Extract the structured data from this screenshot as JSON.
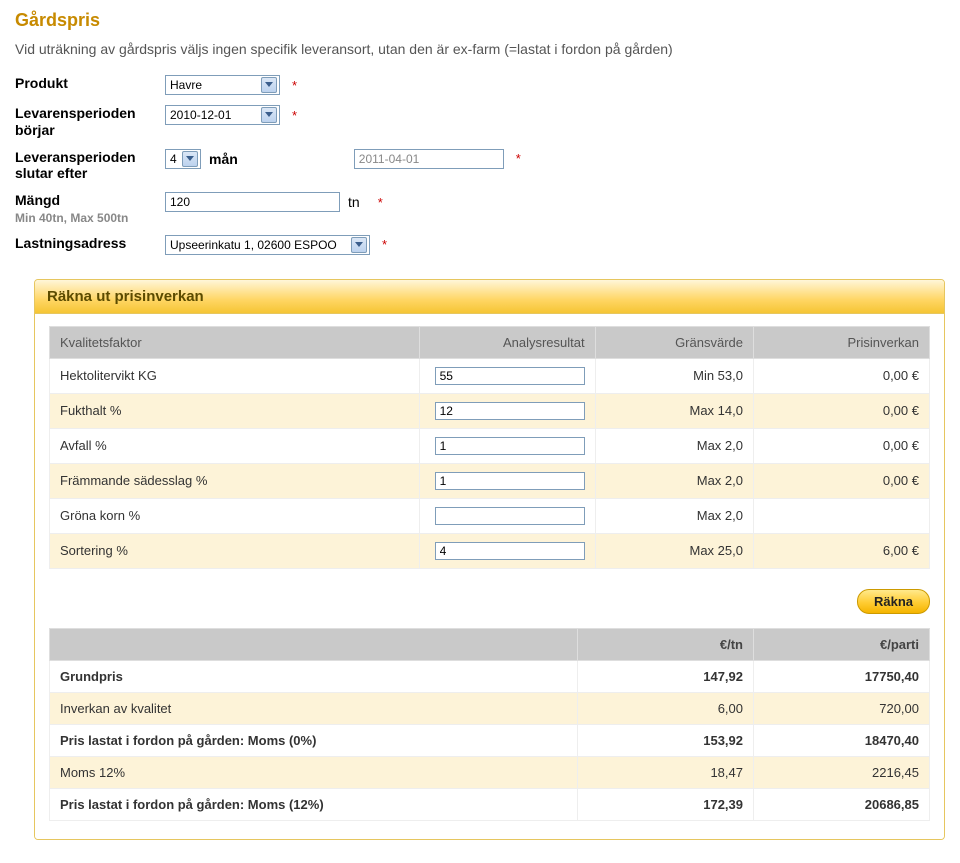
{
  "page": {
    "title": "Gårdspris",
    "intro": "Vid uträkning av gårdspris väljs ingen specifik leveransort, utan den är ex-farm (=lastat i fordon på gården)"
  },
  "form": {
    "produkt": {
      "label": "Produkt",
      "value": "Havre"
    },
    "lev_start": {
      "label": "Levarensperioden börjar",
      "value": "2010-12-01"
    },
    "lev_slut": {
      "label": "Leveransperioden slutar efter",
      "months_value": "4",
      "months_unit": "mån",
      "end_date": "2011-04-01"
    },
    "mangd": {
      "label": "Mängd",
      "value": "120",
      "unit": "tn",
      "sub": "Min 40tn, Max 500tn"
    },
    "lastning": {
      "label": "Lastningsadress",
      "value": "Upseerinkatu 1, 02600 ESPOO"
    }
  },
  "panel": {
    "title": "Räkna ut prisinverkan",
    "headers": {
      "c1": "Kvalitetsfaktor",
      "c2": "Analysresultat",
      "c3": "Gränsvärde",
      "c4": "Prisinverkan"
    },
    "rows": [
      {
        "name": "Hektolitervikt KG",
        "val": "55",
        "limit": "Min 53,0",
        "price": "0,00 €"
      },
      {
        "name": "Fukthalt %",
        "val": "12",
        "limit": "Max 14,0",
        "price": "0,00 €"
      },
      {
        "name": "Avfall %",
        "val": "1",
        "limit": "Max 2,0",
        "price": "0,00 €"
      },
      {
        "name": "Främmande sädesslag %",
        "val": "1",
        "limit": "Max 2,0",
        "price": "0,00 €"
      },
      {
        "name": "Gröna korn %",
        "val": "",
        "limit": "Max 2,0",
        "price": ""
      },
      {
        "name": "Sortering %",
        "val": "4",
        "limit": "Max 25,0",
        "price": "6,00 €"
      }
    ],
    "calc_button": "Räkna",
    "result_headers": {
      "c1": "",
      "c2": "€/tn",
      "c3": "€/parti"
    },
    "result_rows": [
      {
        "label": "Grundpris",
        "pertn": "147,92",
        "parti": "17750,40",
        "bold": true
      },
      {
        "label": "Inverkan av kvalitet",
        "pertn": "6,00",
        "parti": "720,00",
        "bold": false
      },
      {
        "label": "Pris lastat i fordon på gården: Moms (0%)",
        "pertn": "153,92",
        "parti": "18470,40",
        "bold": true
      },
      {
        "label": "Moms 12%",
        "pertn": "18,47",
        "parti": "2216,45",
        "bold": false
      },
      {
        "label": "Pris lastat i fordon på gården: Moms (12%)",
        "pertn": "172,39",
        "parti": "20686,85",
        "bold": true
      }
    ]
  }
}
